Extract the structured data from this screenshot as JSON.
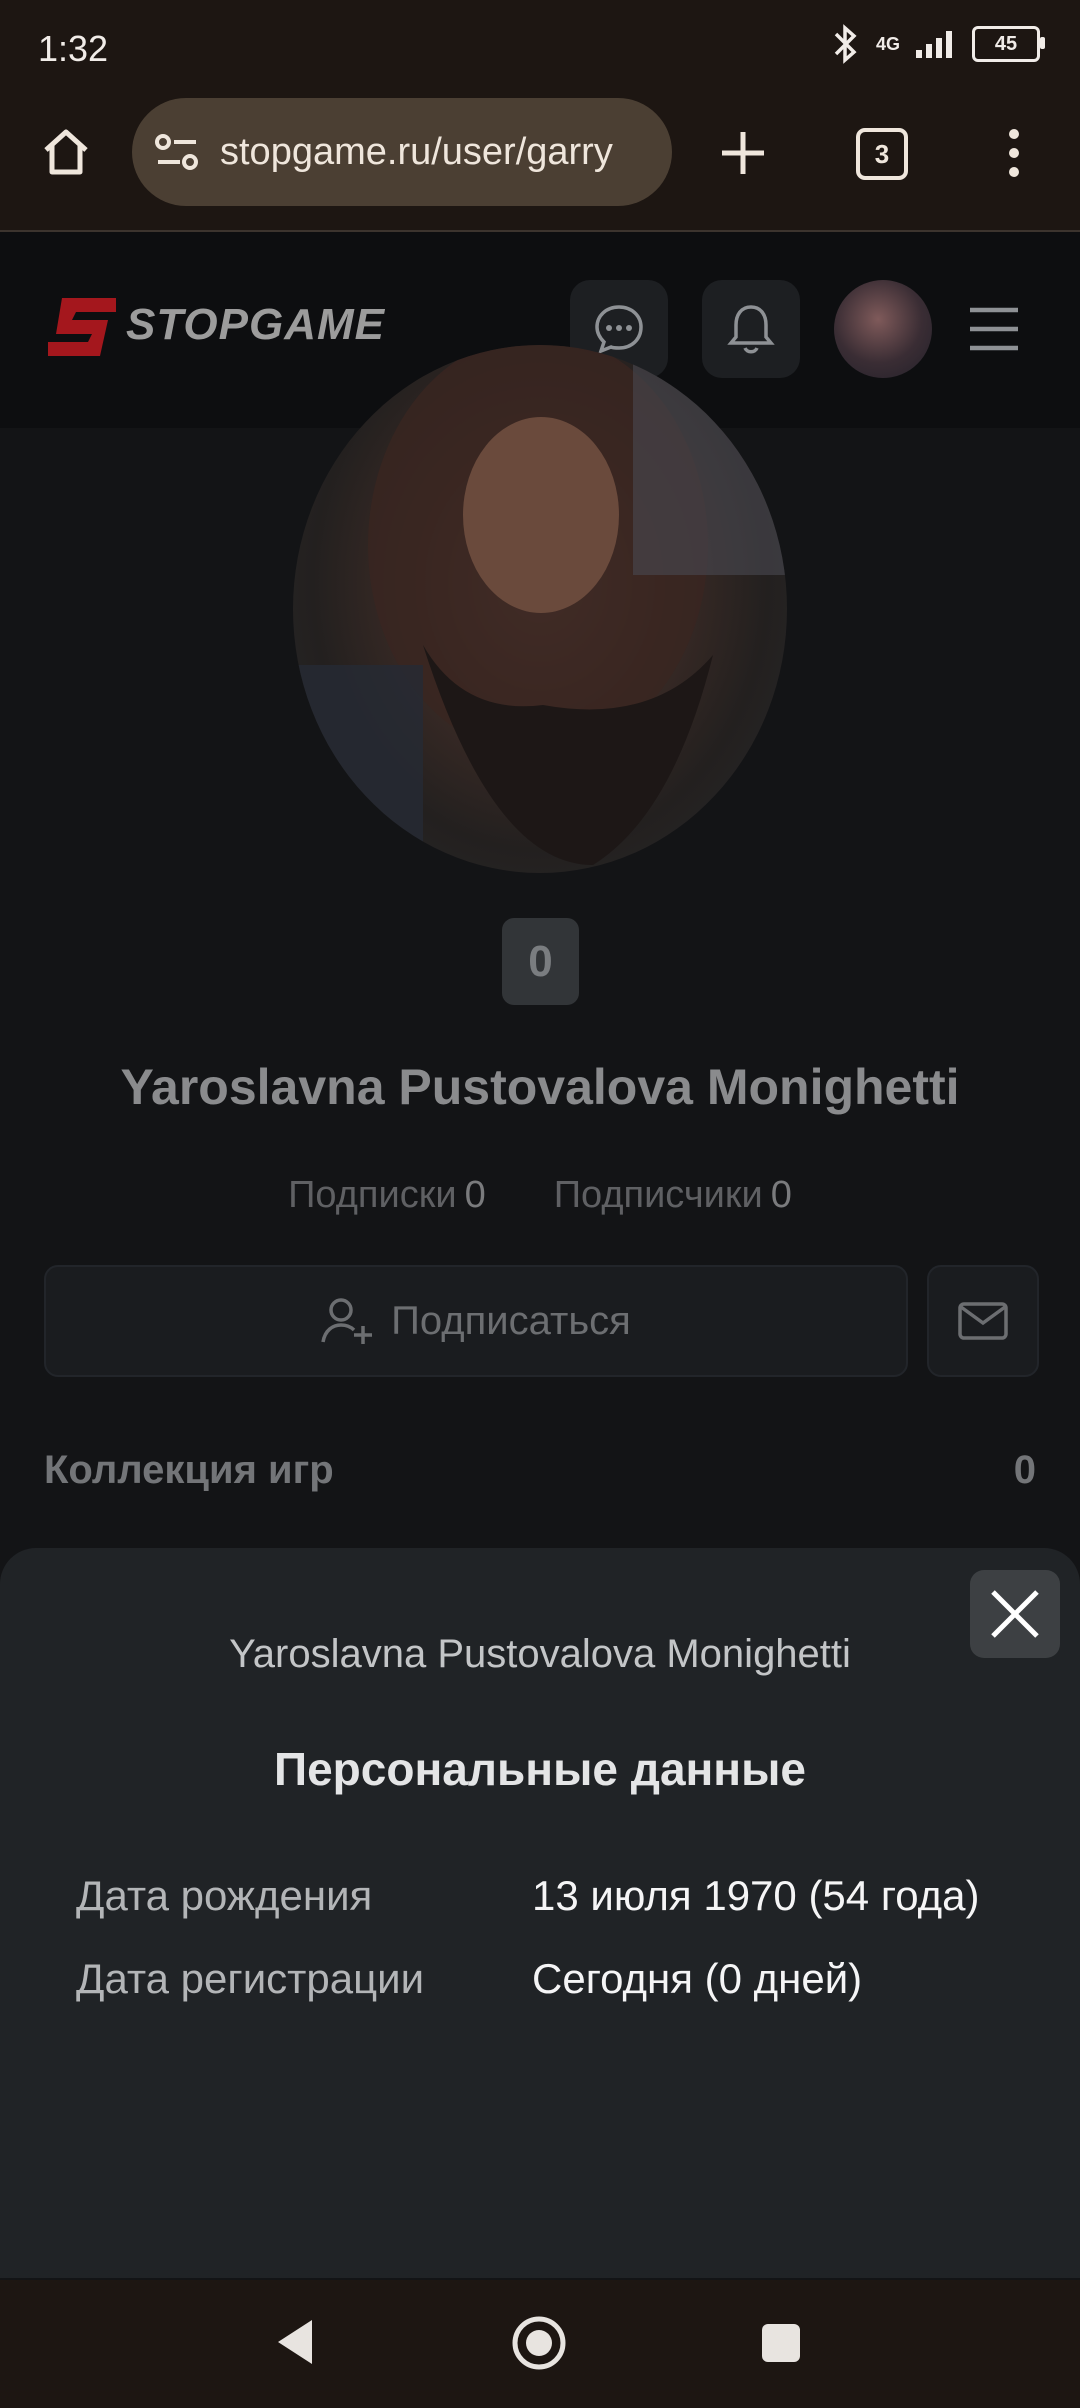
{
  "status_bar": {
    "time": "1:32",
    "network": "4G",
    "battery": "45"
  },
  "browser": {
    "url": "stopgame.ru/user/garry",
    "tab_count": "3"
  },
  "site": {
    "logo": "STOPGAME"
  },
  "profile": {
    "rating": "0",
    "name": "Yaroslavna Pustovalova Monighetti",
    "subscriptions_label": "Подписки",
    "subscriptions_count": "0",
    "subscribers_label": "Подписчики",
    "subscribers_count": "0",
    "subscribe_label": "Подписаться",
    "collection_label": "Коллекция игр",
    "collection_count": "0"
  },
  "sheet": {
    "username": "Yaroslavna Pustovalova Monighetti",
    "title": "Персональные данные",
    "rows": [
      {
        "label": "Дата рождения",
        "value": "13 июля 1970 (54 года)"
      },
      {
        "label": "Дата регистрации",
        "value": "Сегодня (0 дней)"
      }
    ]
  },
  "colors": {
    "brand_red": "#c0272d",
    "sheet_bg": "#202326",
    "page_bg": "#131416"
  },
  "icons": [
    "home-icon",
    "tune-icon",
    "plus-icon",
    "tabs-icon",
    "more-vert-icon",
    "chat-icon",
    "bell-icon",
    "menu-icon",
    "add-user-icon",
    "mail-icon",
    "close-icon",
    "back-icon",
    "home-nav-icon",
    "recents-icon"
  ]
}
